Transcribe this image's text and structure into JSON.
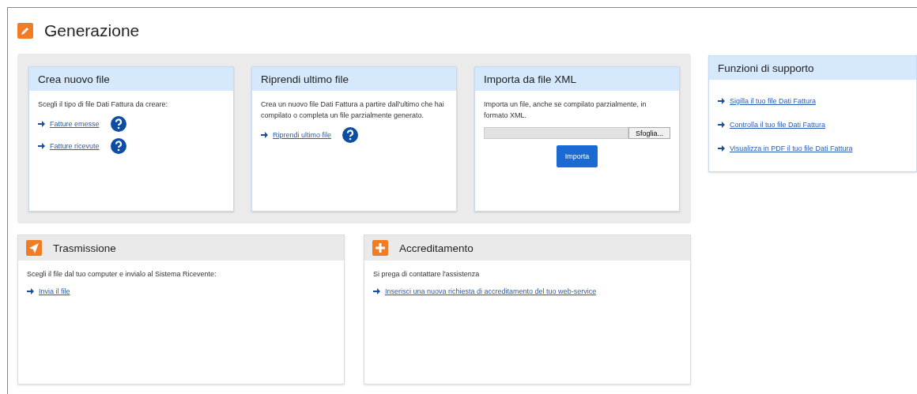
{
  "section": {
    "title": "Generazione"
  },
  "cards": [
    {
      "kind": "links",
      "title": "Crea nuovo file",
      "text": "Scegli il tipo di file Dati Fattura da creare:",
      "links": [
        {
          "label": "Fatture emesse",
          "help": true
        },
        {
          "label": "Fatture ricevute",
          "help": true
        }
      ]
    },
    {
      "kind": "links",
      "title": "Riprendi ultimo file",
      "text": "Crea un nuovo file Dati Fattura a partire dall'ultimo che hai compilato o completa un file parzialmente generato.",
      "links": [
        {
          "label": "Riprendi ultimo file",
          "help": true
        }
      ]
    },
    {
      "kind": "upload",
      "title": "Importa da file XML",
      "text": "Importa un file, anche se compilato parzialmente, in formato XML.",
      "browse": "Sfoglia...",
      "button": "Importa"
    }
  ],
  "support": {
    "title": "Funzioni di supporto",
    "links": [
      {
        "label": "Sigilla il tuo file Dati Fattura"
      },
      {
        "label": "Controlla il tuo file Dati Fattura"
      },
      {
        "label": "Visualizza in PDF il tuo file Dati Fattura"
      }
    ]
  },
  "panels": [
    {
      "title": "Trasmissione",
      "text": "Scegli il file dal tuo computer e invialo al Sistema Ricevente:",
      "links": [
        {
          "label": "Invia il file"
        }
      ]
    },
    {
      "title": "Accreditamento",
      "text": "Si prega di contattare l'assistenza",
      "links": [
        {
          "label": "Inserisci una nuova richiesta di accreditamento del tuo web-service"
        }
      ]
    }
  ]
}
